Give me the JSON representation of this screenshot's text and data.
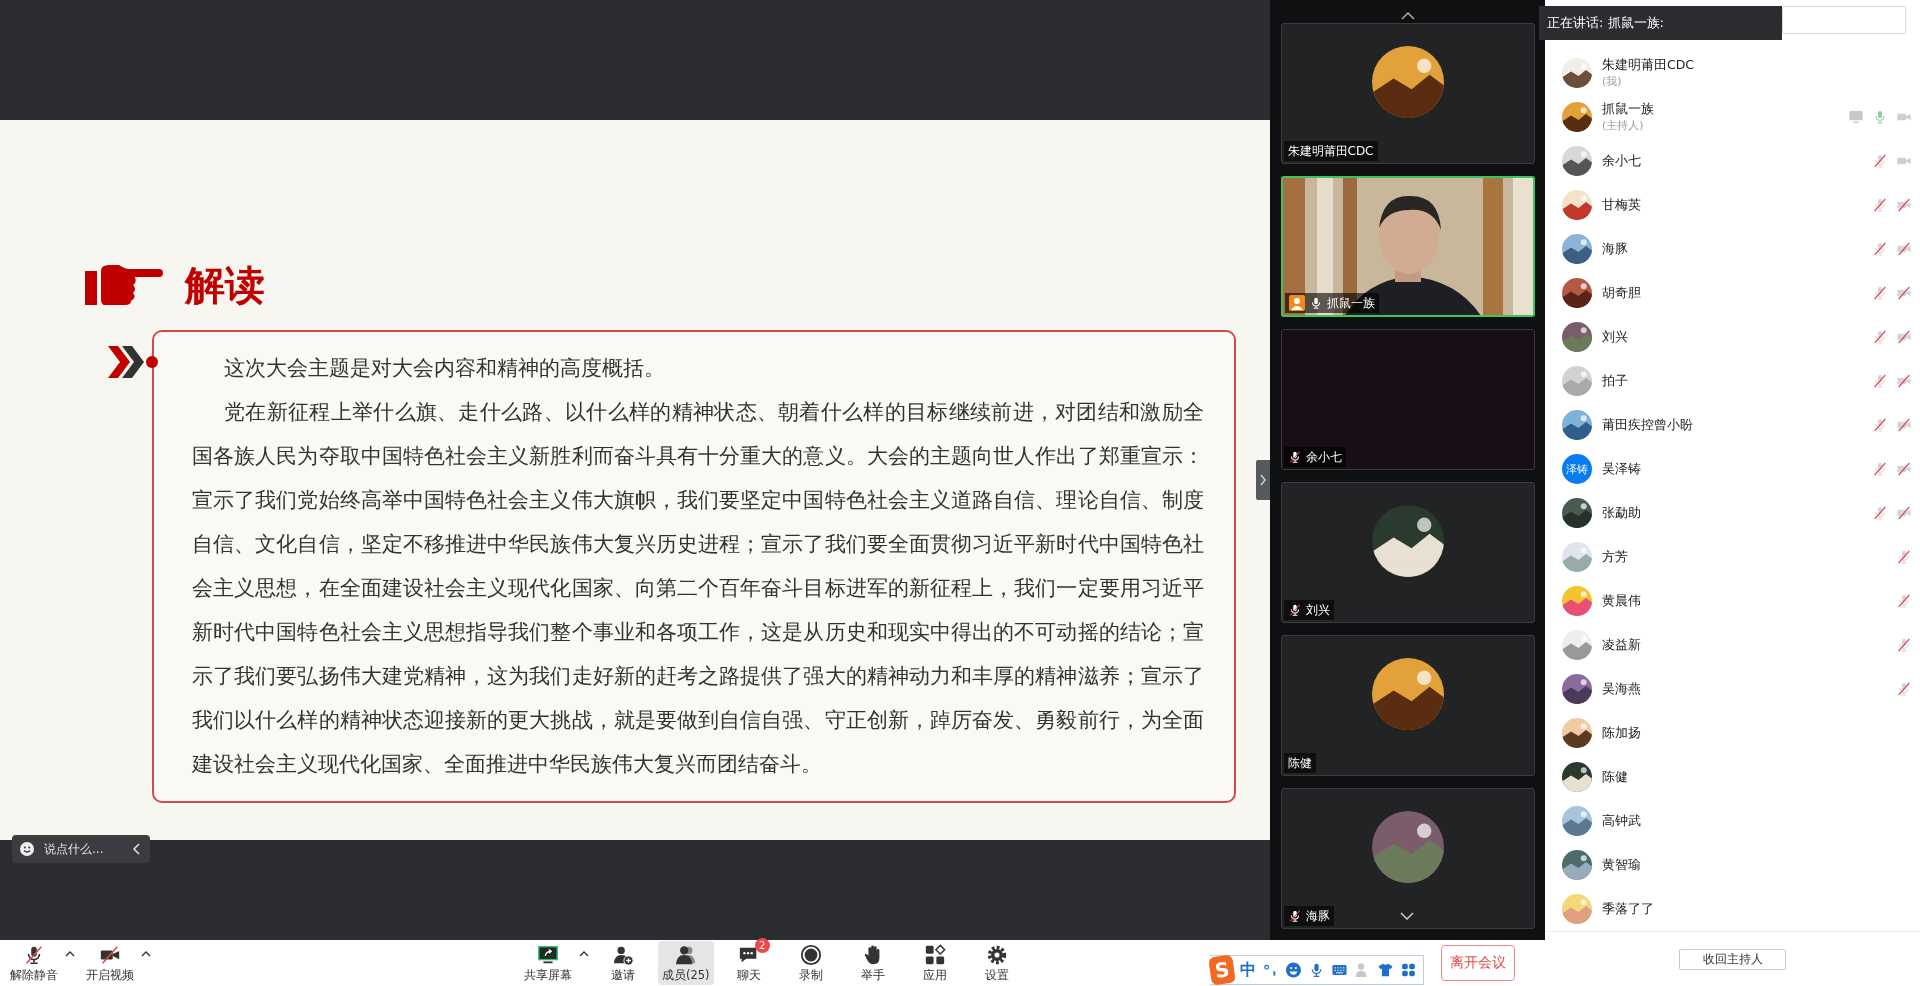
{
  "slide": {
    "heading": "解读",
    "paragraphs": [
      "这次大会主题是对大会内容和精神的高度概括。",
      "党在新征程上举什么旗、走什么路、以什么样的精神状态、朝着什么样的目标继续前进，对团结和激励全国各族人民为夺取中国特色社会主义新胜利而奋斗具有十分重大的意义。大会的主题向世人作出了郑重宣示：宣示了我们党始终高举中国特色社会主义伟大旗帜，我们要坚定中国特色社会主义道路自信、理论自信、制度自信、文化自信，坚定不移推进中华民族伟大复兴历史进程；宣示了我们要全面贯彻习近平新时代中国特色社会主义思想，在全面建设社会主义现代化国家、向第二个百年奋斗目标进军的新征程上，我们一定要用习近平新时代中国特色社会主义思想指导我们整个事业和各项工作，这是从历史和现实中得出的不可动摇的结论；宣示了我们要弘扬伟大建党精神，这为我们走好新的赶考之路提供了强大的精神动力和丰厚的精神滋养；宣示了我们以什么样的精神状态迎接新的更大挑战，就是要做到自信自强、守正创新，踔厉奋发、勇毅前行，为全面建设社会主义现代化国家、全面推进中华民族伟大复兴而团结奋斗。"
    ]
  },
  "chat_input": {
    "placeholder": "说点什么..."
  },
  "video_tiles": [
    {
      "name": "朱建明莆田CDC",
      "kind": "avatar",
      "speaking": false
    },
    {
      "name": "抓鼠一族",
      "kind": "video",
      "speaking": true,
      "host": true,
      "mic_muted": false
    },
    {
      "name": "余小七",
      "kind": "blank",
      "speaking": false,
      "mic_muted": true
    },
    {
      "name": "刘兴",
      "kind": "avatar",
      "speaking": false,
      "mic_muted": true
    },
    {
      "name": "陈健",
      "kind": "avatar",
      "speaking": false
    },
    {
      "name": "海豚",
      "kind": "avatar",
      "speaking": false,
      "mic_muted": true
    }
  ],
  "speaking_banner": "正在讲话: 抓鼠一族:",
  "participants": [
    {
      "name": "朱建明莆田CDC",
      "role": "(我)"
    },
    {
      "name": "抓鼠一族",
      "role": "(主持人)",
      "sharing": true,
      "mic_muted": false,
      "camera_off": false
    },
    {
      "name": "余小七",
      "mic_muted": true,
      "camera_off": false
    },
    {
      "name": "甘梅英",
      "mic_muted": true,
      "camera_off": true
    },
    {
      "name": "海豚",
      "mic_muted": true,
      "camera_off": true
    },
    {
      "name": "胡奇胆",
      "mic_muted": true,
      "camera_off": true
    },
    {
      "name": "刘兴",
      "mic_muted": true,
      "camera_off": true
    },
    {
      "name": "拍子",
      "mic_muted": true,
      "camera_off": true
    },
    {
      "name": "莆田疾控曾小盼",
      "mic_muted": true,
      "camera_off": true
    },
    {
      "name": "吴泽铸",
      "avatar_text": "泽铸",
      "mic_muted": true,
      "camera_off": true
    },
    {
      "name": "张勐助",
      "mic_muted": true,
      "camera_off": true
    },
    {
      "name": "方芳",
      "mic_muted": true
    },
    {
      "name": "黄晨伟",
      "mic_muted": true
    },
    {
      "name": "凌益新",
      "mic_muted": true
    },
    {
      "name": "吴海燕",
      "mic_muted": true
    },
    {
      "name": "陈加扬"
    },
    {
      "name": "陈健"
    },
    {
      "name": "高钟武"
    },
    {
      "name": "黄智瑜"
    },
    {
      "name": "季落了了"
    }
  ],
  "reclaim_host_button": "收回主持人",
  "toolbar": {
    "left": [
      {
        "label": "解除静音",
        "kind": "mic-off",
        "menu": true
      },
      {
        "label": "开启视频",
        "kind": "camera-off",
        "menu": true
      }
    ],
    "center": [
      {
        "label": "共享屏幕",
        "kind": "share",
        "menu": true,
        "selected": false
      },
      {
        "label": "邀请",
        "kind": "invite",
        "selected": false
      },
      {
        "label": "成员(25)",
        "kind": "members",
        "selected": true
      },
      {
        "label": "聊天",
        "kind": "chat",
        "badge": "2",
        "selected": false
      },
      {
        "label": "录制",
        "kind": "record",
        "selected": false
      },
      {
        "label": "举手",
        "kind": "hand",
        "selected": false
      },
      {
        "label": "应用",
        "kind": "apps",
        "selected": false
      },
      {
        "label": "设置",
        "kind": "settings",
        "selected": false
      }
    ],
    "leave_button": "离开会议"
  },
  "ime": {
    "logo": "S",
    "mode": "中"
  }
}
